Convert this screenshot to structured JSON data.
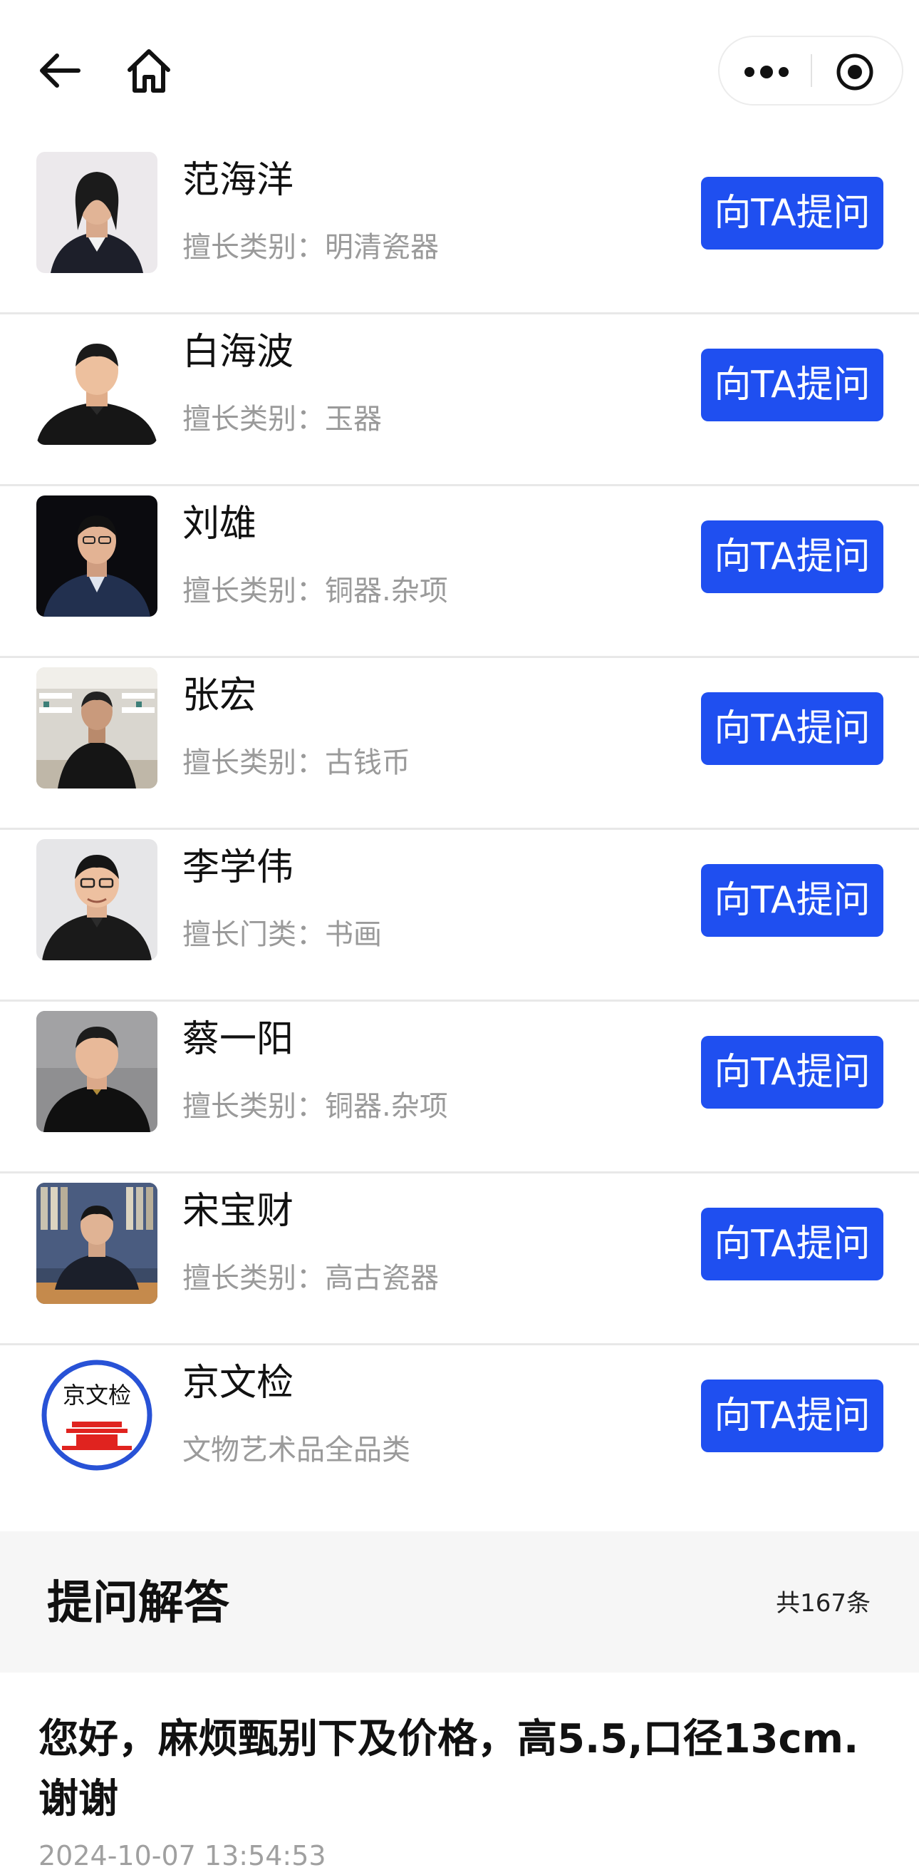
{
  "nav": {
    "back_icon": "arrow-left-icon",
    "home_icon": "home-icon",
    "more_icon": "more-dots-icon",
    "close_icon": "target-circle-icon"
  },
  "experts": [
    {
      "name": "范海洋",
      "specialty": "擅长类别：明清瓷器",
      "button": "向TA提问"
    },
    {
      "name": "白海波",
      "specialty": "擅长类别：玉器",
      "button": "向TA提问"
    },
    {
      "name": "刘雄",
      "specialty": "擅长类别：铜器.杂项",
      "button": "向TA提问"
    },
    {
      "name": "张宏",
      "specialty": "擅长类别：古钱币",
      "button": "向TA提问"
    },
    {
      "name": "李学伟",
      "specialty": "擅长门类：书画",
      "button": "向TA提问"
    },
    {
      "name": "蔡一阳",
      "specialty": "擅长类别：铜器.杂项",
      "button": "向TA提问"
    },
    {
      "name": "宋宝财",
      "specialty": "擅长类别：高古瓷器",
      "button": "向TA提问"
    },
    {
      "name": "京文检",
      "specialty": "文物艺术品全品类",
      "button": "向TA提问",
      "logo_text": "京文检"
    }
  ],
  "qa": {
    "title": "提问解答",
    "count": "共167条",
    "items": [
      {
        "question": "您好，麻烦甄别下及价格，高5.5,口径13cm.谢谢",
        "time": "2024-10-07 13:54:53"
      }
    ]
  },
  "colors": {
    "button_bg": "#1f4ff0",
    "button_text": "#ffffff",
    "specialty_text": "#9a9a9a",
    "section_bg": "#f6f6f6"
  }
}
